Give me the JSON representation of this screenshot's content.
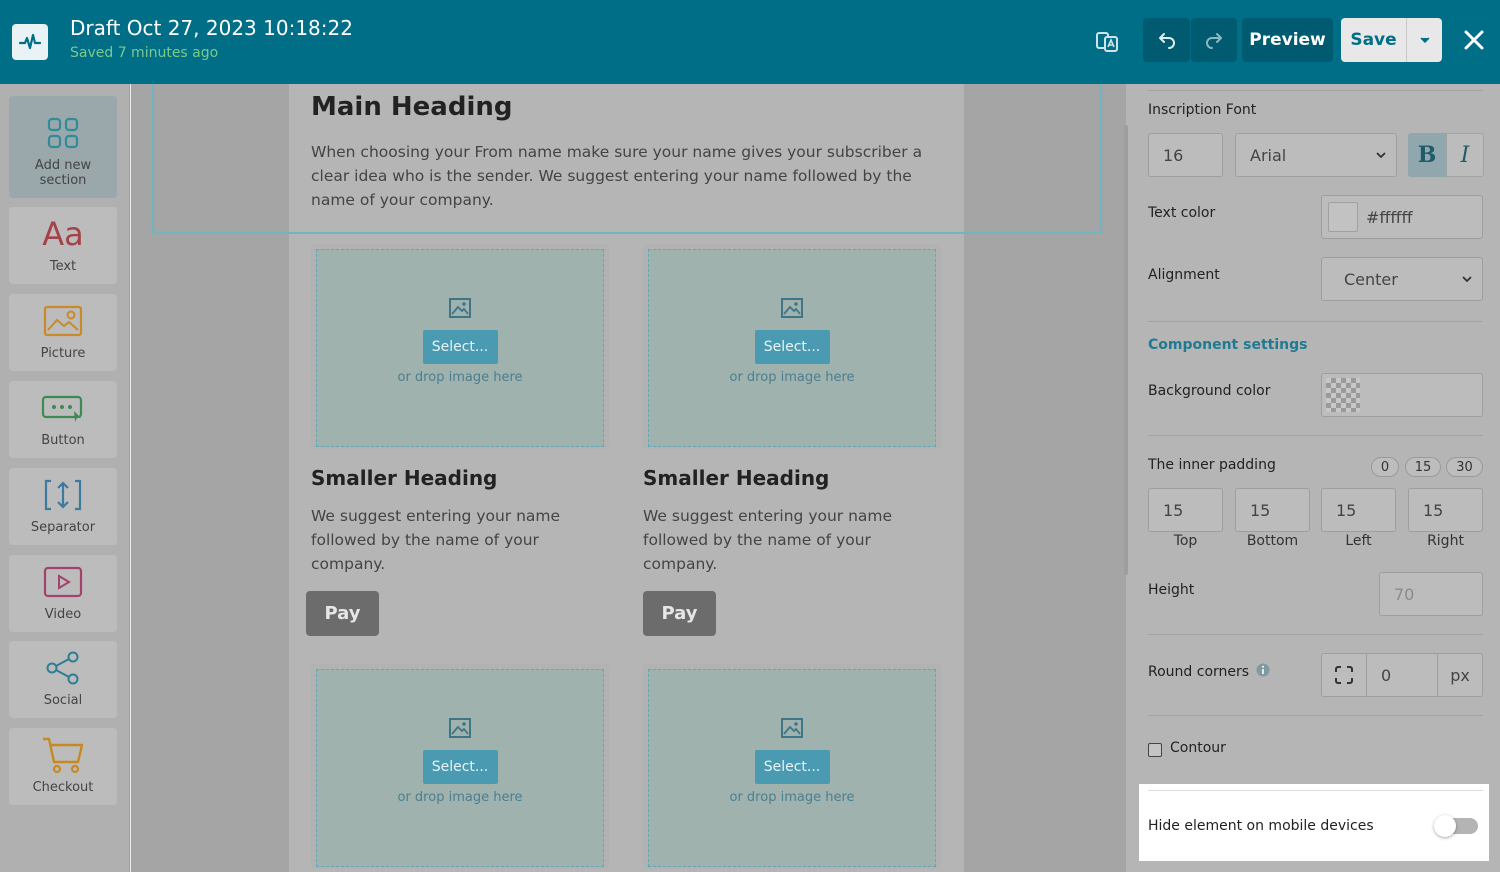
{
  "header": {
    "title": "Draft Oct 27, 2023 10:18:22",
    "subtitle": "Saved 7 minutes ago",
    "preview_label": "Preview",
    "save_label": "Save"
  },
  "sidebar": {
    "items": [
      {
        "label": "Add new section",
        "icon": "grid-icon"
      },
      {
        "label": "Text",
        "icon": "text-aa-icon"
      },
      {
        "label": "Picture",
        "icon": "picture-icon"
      },
      {
        "label": "Button",
        "icon": "button-icon"
      },
      {
        "label": "Separator",
        "icon": "separator-icon"
      },
      {
        "label": "Video",
        "icon": "video-icon"
      },
      {
        "label": "Social",
        "icon": "share-icon"
      },
      {
        "label": "Checkout",
        "icon": "cart-icon"
      }
    ]
  },
  "canvas": {
    "main_heading": "Main Heading",
    "main_paragraph": "When choosing your From name make sure your name gives your subscriber a clear idea who is the sender. We suggest entering your name followed by the name of your company.",
    "image_placeholder": {
      "select_label": "Select...",
      "drop_text": "or drop image here"
    },
    "columns": [
      {
        "heading": "Smaller Heading",
        "paragraph": "We suggest entering your name followed by the name of your company.",
        "button": "Pay"
      },
      {
        "heading": "Smaller Heading",
        "paragraph": "We suggest entering your name followed by the name of your company.",
        "button": "Pay"
      }
    ]
  },
  "panel": {
    "inscription_font": {
      "label": "Inscription Font",
      "size": "16",
      "family": "Arial",
      "bold": "B",
      "italic": "I"
    },
    "text_color": {
      "label": "Text color",
      "value": "#ffffff"
    },
    "alignment": {
      "label": "Alignment",
      "value": "Center"
    },
    "component_settings": "Component settings",
    "background_color": {
      "label": "Background color"
    },
    "inner_padding": {
      "label": "The inner padding",
      "presets": [
        "0",
        "15",
        "30"
      ],
      "top": "15",
      "bottom": "15",
      "left": "15",
      "right": "15",
      "top_label": "Top",
      "bottom_label": "Bottom",
      "left_label": "Left",
      "right_label": "Right"
    },
    "height": {
      "label": "Height",
      "placeholder": "70"
    },
    "round_corners": {
      "label": "Round corners",
      "value": "0",
      "unit": "px"
    },
    "contour": {
      "label": "Contour",
      "checked": false
    },
    "hide_mobile": {
      "label": "Hide element on mobile devices",
      "enabled": false
    }
  },
  "colors": {
    "topbar": "#006e87",
    "accent": "#1f7a92",
    "saved_status": "#7cc98b"
  }
}
